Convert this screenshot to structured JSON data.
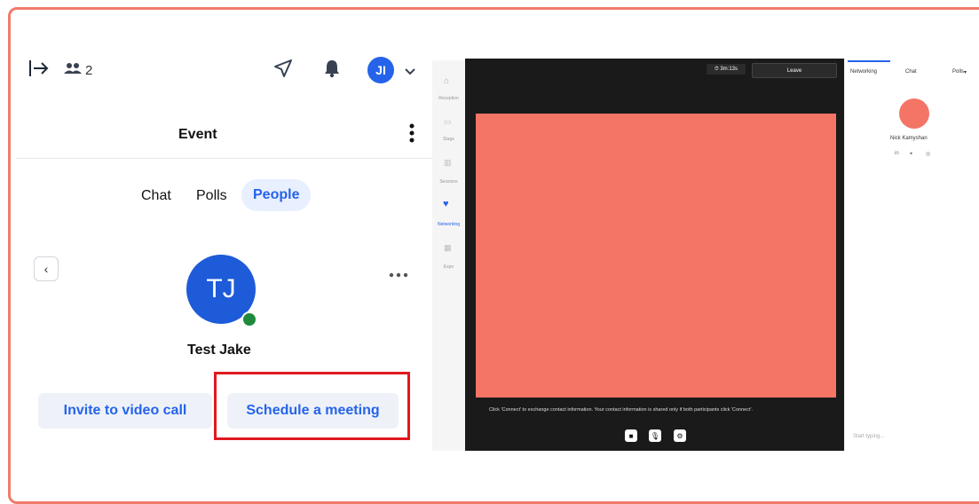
{
  "colors": {
    "frame": "#f07b6b",
    "accent": "#2563eb",
    "highlight": "#e0191f",
    "online": "#1f8a3b",
    "video": "#f47465"
  },
  "topbar": {
    "people_count": "2",
    "user_initials": "JI",
    "icons": [
      "exit-icon",
      "people-icon",
      "send-icon",
      "bell-icon",
      "chevron-down-icon"
    ]
  },
  "panel": {
    "title": "Event",
    "tabs": [
      {
        "label": "Chat"
      },
      {
        "label": "Polls"
      },
      {
        "label": "People",
        "active": true
      }
    ]
  },
  "profile": {
    "initials": "TJ",
    "name": "Test Jake",
    "online": true
  },
  "actions": {
    "invite": "Invite to video call",
    "schedule": "Schedule a meeting"
  },
  "mock": {
    "nav": [
      "Reception",
      "Stage",
      "Sessions",
      "Networking",
      "Expo"
    ],
    "timer": "⏱ 3m:13s",
    "leave": "Leave",
    "caption": "Click 'Connect' to exchange contact information. Your contact information is shared only if both participants click 'Connect'.",
    "tabs": [
      "Networking",
      "Chat",
      "Polls"
    ],
    "person": "Nick Kamyshan",
    "input_placeholder": "Start typing..."
  }
}
